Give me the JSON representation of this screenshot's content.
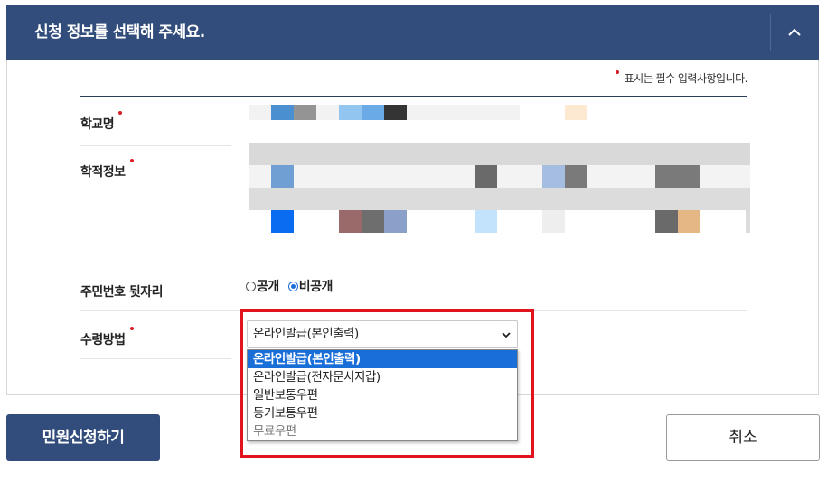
{
  "header": {
    "title": "신청 정보를 선택해 주세요.",
    "collapse_icon": "chevron-up-icon"
  },
  "required_note": "표시는 필수 입력사항입니다.",
  "colors": {
    "primary": "#324d7b",
    "required_dot": "#d81f26",
    "highlight_border": "#e0141c",
    "selected_option": "#1a6ed8"
  },
  "form": {
    "school_name_label": "학교명",
    "academic_info_label": "학적정보",
    "rrn_label": "주민번호 뒷자리",
    "rrn_options": [
      {
        "label": "공개",
        "checked": false
      },
      {
        "label": "비공개",
        "checked": true
      }
    ],
    "receipt_label": "수령방법",
    "receipt_select": {
      "value": "온라인발급(본인출력)",
      "options": [
        {
          "label": "온라인발급(본인출력)",
          "selected": true,
          "disabled": false
        },
        {
          "label": "온라인발급(전자문서지갑)",
          "selected": false,
          "disabled": false
        },
        {
          "label": "일반보통우편",
          "selected": false,
          "disabled": false
        },
        {
          "label": "등기보통우편",
          "selected": false,
          "disabled": false
        },
        {
          "label": "무료우편",
          "selected": false,
          "disabled": true
        }
      ]
    }
  },
  "buttons": {
    "submit": "민원신청하기",
    "cancel": "취소"
  }
}
